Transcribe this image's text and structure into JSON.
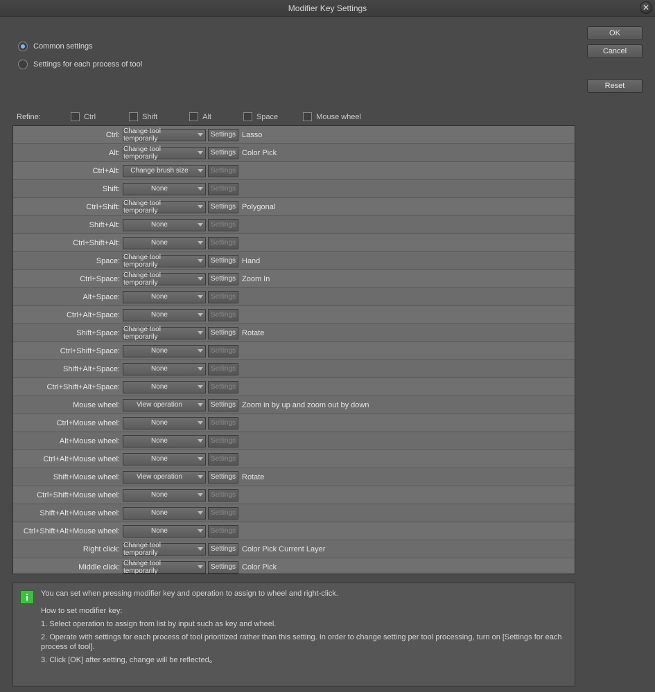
{
  "window": {
    "title": "Modifier Key Settings"
  },
  "buttons": {
    "ok": "OK",
    "cancel": "Cancel",
    "reset": "Reset"
  },
  "radios": {
    "common": "Common settings",
    "per_tool": "Settings for each process of tool",
    "selected": "common"
  },
  "refine": {
    "label": "Refine:",
    "ctrl": "Ctrl",
    "shift": "Shift",
    "alt": "Alt",
    "space": "Space",
    "wheel": "Mouse wheel"
  },
  "opts": {
    "change_tool": "Change tool temporarily",
    "brush": "Change brush size",
    "none": "None",
    "view": "View operation"
  },
  "settings_label": "Settings",
  "rows": [
    {
      "key": "Ctrl:",
      "sel": "change_tool",
      "enabled": true,
      "desc": "Lasso"
    },
    {
      "key": "Alt:",
      "sel": "change_tool",
      "enabled": true,
      "desc": "Color Pick"
    },
    {
      "key": "Ctrl+Alt:",
      "sel": "brush",
      "enabled": false,
      "desc": ""
    },
    {
      "key": "Shift:",
      "sel": "none",
      "enabled": false,
      "desc": ""
    },
    {
      "key": "Ctrl+Shift:",
      "sel": "change_tool",
      "enabled": true,
      "desc": "Polygonal"
    },
    {
      "key": "Shift+Alt:",
      "sel": "none",
      "enabled": false,
      "desc": ""
    },
    {
      "key": "Ctrl+Shift+Alt:",
      "sel": "none",
      "enabled": false,
      "desc": ""
    },
    {
      "key": "Space:",
      "sel": "change_tool",
      "enabled": true,
      "desc": "Hand"
    },
    {
      "key": "Ctrl+Space:",
      "sel": "change_tool",
      "enabled": true,
      "desc": "Zoom In"
    },
    {
      "key": "Alt+Space:",
      "sel": "none",
      "enabled": false,
      "desc": ""
    },
    {
      "key": "Ctrl+Alt+Space:",
      "sel": "none",
      "enabled": false,
      "desc": ""
    },
    {
      "key": "Shift+Space:",
      "sel": "change_tool",
      "enabled": true,
      "desc": "Rotate"
    },
    {
      "key": "Ctrl+Shift+Space:",
      "sel": "none",
      "enabled": false,
      "desc": ""
    },
    {
      "key": "Shift+Alt+Space:",
      "sel": "none",
      "enabled": false,
      "desc": ""
    },
    {
      "key": "Ctrl+Shift+Alt+Space:",
      "sel": "none",
      "enabled": false,
      "desc": ""
    },
    {
      "key": "Mouse wheel:",
      "sel": "view",
      "enabled": true,
      "desc": "Zoom in by up and zoom out by down"
    },
    {
      "key": "Ctrl+Mouse wheel:",
      "sel": "none",
      "enabled": false,
      "desc": ""
    },
    {
      "key": "Alt+Mouse wheel:",
      "sel": "none",
      "enabled": false,
      "desc": ""
    },
    {
      "key": "Ctrl+Alt+Mouse wheel:",
      "sel": "none",
      "enabled": false,
      "desc": ""
    },
    {
      "key": "Shift+Mouse wheel:",
      "sel": "view",
      "enabled": true,
      "desc": "Rotate"
    },
    {
      "key": "Ctrl+Shift+Mouse wheel:",
      "sel": "none",
      "enabled": false,
      "desc": ""
    },
    {
      "key": "Shift+Alt+Mouse wheel:",
      "sel": "none",
      "enabled": false,
      "desc": ""
    },
    {
      "key": "Ctrl+Shift+Alt+Mouse wheel:",
      "sel": "none",
      "enabled": false,
      "desc": ""
    },
    {
      "key": "Right click:",
      "sel": "change_tool",
      "enabled": true,
      "desc": "Color Pick Current Layer"
    },
    {
      "key": "Middle click:",
      "sel": "change_tool",
      "enabled": true,
      "desc": "Color Pick"
    }
  ],
  "info": {
    "line1": "You can set when pressing modifier key and operation to assign to wheel and right-click.",
    "line2": "How to set modifier key:",
    "line3": "1. Select operation to assign from list by input such as key and wheel.",
    "line4": "2. Operate with settings for each process of tool prioritized rather than this setting. In order to change setting per tool processing, turn on [Settings for each process of tool].",
    "line5": "3. Click [OK] after setting, change will be reflected。"
  }
}
